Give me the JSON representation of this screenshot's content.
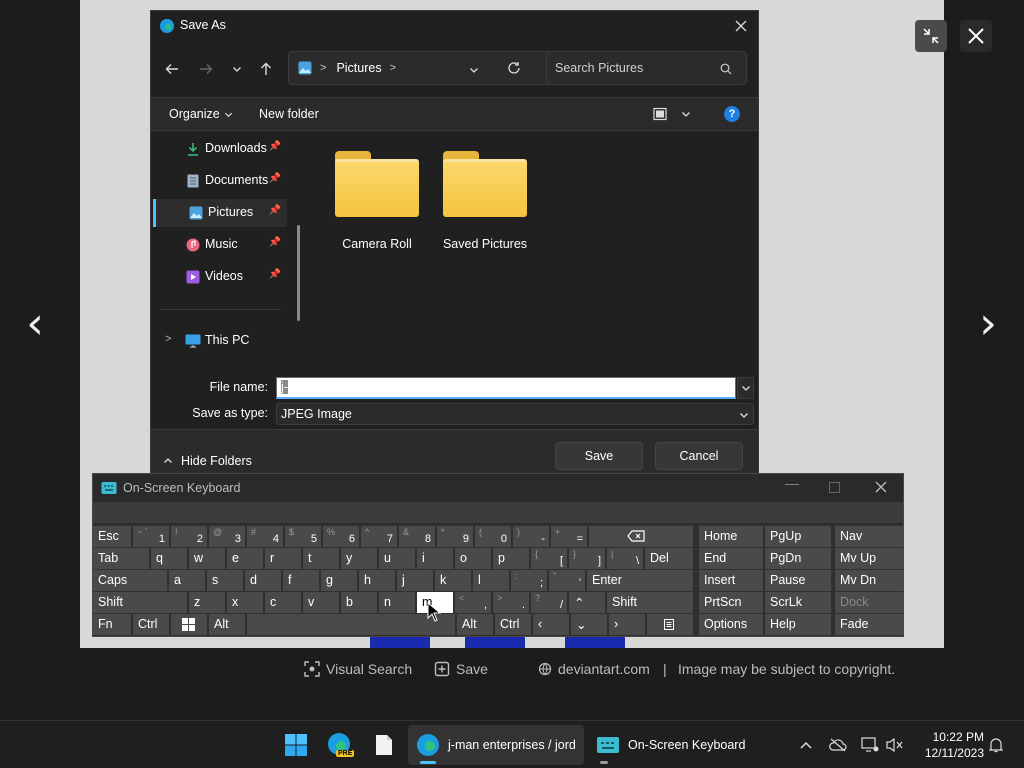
{
  "viewer": {
    "prev_arrow": "‹",
    "next_arrow": "›",
    "visual_search_label": "Visual Search",
    "save_label": "Save",
    "source_label": "deviantart.com",
    "separator": "|",
    "copyright_notice": "Image may be subject to copyright."
  },
  "dialog": {
    "title": "Save As",
    "breadcrumb": "Pictures",
    "search_placeholder": "Search Pictures",
    "organize_label": "Organize",
    "new_folder_label": "New folder",
    "nav_items": [
      {
        "label": "Downloads"
      },
      {
        "label": "Documents"
      },
      {
        "label": "Pictures"
      },
      {
        "label": "Music"
      },
      {
        "label": "Videos"
      },
      {
        "label": "This PC"
      }
    ],
    "folders": [
      {
        "name": "Camera Roll"
      },
      {
        "name": "Saved Pictures"
      }
    ],
    "file_name_label": "File name:",
    "file_name_value": "j-",
    "save_type_label": "Save as type:",
    "save_type_value": "JPEG Image",
    "hide_folders_label": "Hide Folders",
    "save_button": "Save",
    "cancel_button": "Cancel"
  },
  "keyboard": {
    "title": "On-Screen Keyboard",
    "keys": {
      "esc": "Esc",
      "tab": "Tab",
      "caps": "Caps",
      "shift": "Shift",
      "shift_r": "Shift",
      "fn": "Fn",
      "ctrl": "Ctrl",
      "alt": "Alt",
      "alt_r": "Alt",
      "ctrl_r": "Ctrl",
      "del": "Del",
      "enter": "Enter",
      "home": "Home",
      "pgup": "PgUp",
      "nav": "Nav",
      "end": "End",
      "pgdn": "PgDn",
      "mvup": "Mv Up",
      "insert": "Insert",
      "pause": "Pause",
      "mvdn": "Mv Dn",
      "prtscn": "PrtScn",
      "scrlk": "ScrLk",
      "dock": "Dock",
      "options": "Options",
      "help": "Help",
      "fade": "Fade",
      "k1": "1",
      "k2": "2",
      "k3": "3",
      "k4": "4",
      "k5": "5",
      "k6": "6",
      "k7": "7",
      "k8": "8",
      "k9": "9",
      "k0": "0",
      "minus": "-",
      "equals": "=",
      "q": "q",
      "w": "w",
      "e": "e",
      "r": "r",
      "t": "t",
      "y": "y",
      "u": "u",
      "i": "i",
      "o": "o",
      "p": "p",
      "lbracket": "[",
      "rbracket": "]",
      "backslash": "\\",
      "a": "a",
      "s": "s",
      "d": "d",
      "f": "f",
      "g": "g",
      "h": "h",
      "j": "j",
      "k": "k",
      "l": "l",
      "semicolon": ";",
      "quote": "'",
      "z": "z",
      "x": "x",
      "c": "c",
      "v": "v",
      "b": "b",
      "n": "n",
      "m": "m",
      "comma": ",",
      "period": ".",
      "slash": "/"
    }
  },
  "taskbar": {
    "edge_app_label": "j-man enterprises / jord",
    "osk_app_label": "On-Screen Keyboard",
    "clock_time": "10:22 PM",
    "clock_date": "12/11/2023",
    "edge_badge": "PRE"
  },
  "colors": {
    "accent": "#4cc2ff",
    "folder": "#f5c43f",
    "dialog_bg": "#202020"
  }
}
